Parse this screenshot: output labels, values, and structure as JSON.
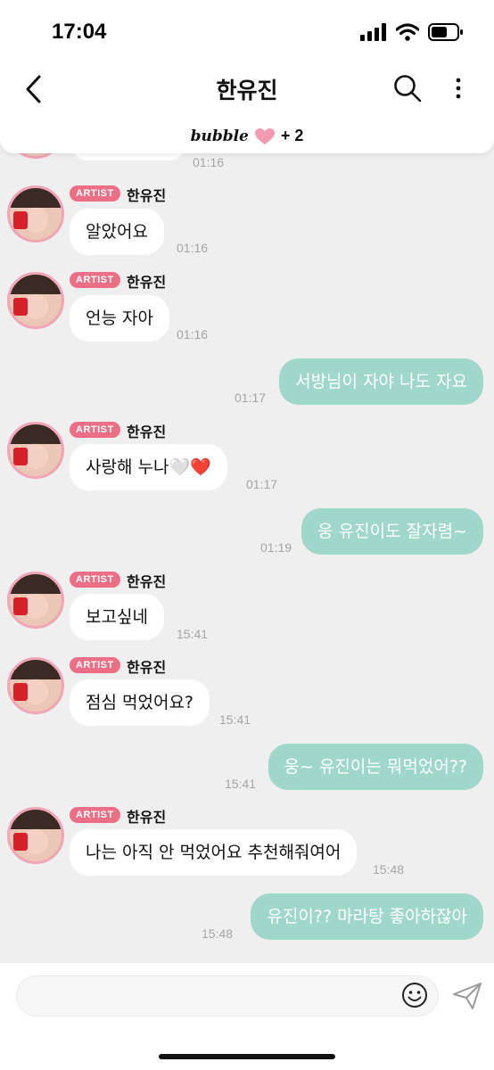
{
  "status_bar": {
    "time": "17:04"
  },
  "header": {
    "title": "한유진",
    "brand_logo": "bubble",
    "brand_plus": "+ 2"
  },
  "messages": [
    {
      "type": "in",
      "text": "",
      "time": "01:16"
    },
    {
      "type": "in",
      "badge": "ARTIST",
      "sender": "한유진",
      "text": "알았어요",
      "time": "01:16"
    },
    {
      "type": "in",
      "badge": "ARTIST",
      "sender": "한유진",
      "text": "언능 자아",
      "time": "01:16"
    },
    {
      "type": "out",
      "text": "서방님이 자야 나도 자요",
      "time": "01:17"
    },
    {
      "type": "in",
      "badge": "ARTIST",
      "sender": "한유진",
      "text": "사랑해 누나🤍❤️",
      "time": "01:17"
    },
    {
      "type": "out",
      "text": "웅 유진이도 잘자렴~",
      "time": "01:19"
    },
    {
      "type": "in",
      "badge": "ARTIST",
      "sender": "한유진",
      "text": "보고싶네",
      "time": "15:41"
    },
    {
      "type": "in",
      "badge": "ARTIST",
      "sender": "한유진",
      "text": "점심 먹었어요?",
      "time": "15:41"
    },
    {
      "type": "out",
      "text": "웅~ 유진이는 뭐먹었어??",
      "time": "15:41"
    },
    {
      "type": "in",
      "badge": "ARTIST",
      "sender": "한유진",
      "text": "나는 아직 안 먹었어요 추천해줘여어",
      "time": "15:48"
    },
    {
      "type": "out",
      "text": "유진이?? 마라탕 좋아하잖아",
      "time": "15:48"
    }
  ],
  "input": {
    "placeholder": ""
  },
  "colors": {
    "outgoing": "#9fd8cb",
    "incoming": "#ffffff",
    "badge": "#ec6f86",
    "background": "#efefef"
  },
  "icons": [
    "back-icon",
    "search-icon",
    "more-icon",
    "heart-icon",
    "emoji-icon",
    "send-icon",
    "signal-icon",
    "wifi-icon",
    "battery-icon"
  ]
}
